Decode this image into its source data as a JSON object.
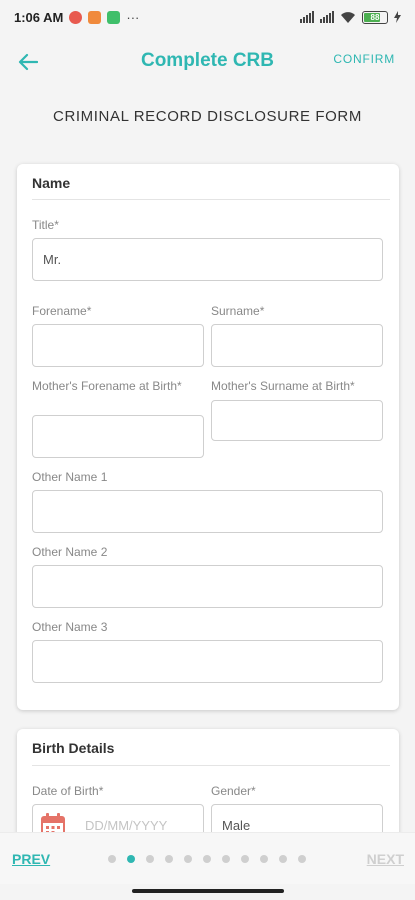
{
  "status": {
    "time": "1:06 AM",
    "overflow": "···",
    "battery": "88"
  },
  "header": {
    "title": "Complete CRB",
    "confirm": "CONFIRM"
  },
  "form_heading": "CRIMINAL RECORD DISCLOSURE FORM",
  "name_card": {
    "title": "Name",
    "title_label": "Title*",
    "title_value": "Mr.",
    "forename_label": "Forename*",
    "surname_label": "Surname*",
    "mother_forename_label": "Mother's Forename at Birth*",
    "mother_surname_label": "Mother's Surname at Birth*",
    "other1_label": "Other Name 1",
    "other2_label": "Other Name 2",
    "other3_label": "Other Name 3"
  },
  "birth_card": {
    "title": "Birth Details",
    "dob_label": "Date of Birth*",
    "dob_placeholder": "DD/MM/YYYY",
    "gender_label": "Gender*",
    "gender_value": "Male"
  },
  "nav": {
    "prev": "PREV",
    "next": "NEXT",
    "page_count": 11,
    "current_page": 2
  },
  "colors": {
    "accent": "#2fb7b2",
    "calendar": "#e57368"
  }
}
